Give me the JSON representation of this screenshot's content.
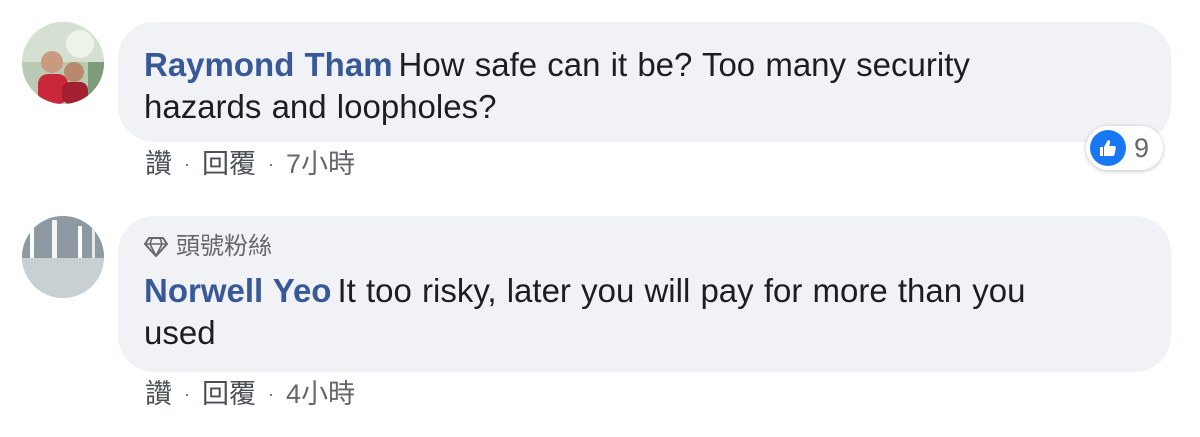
{
  "comments": [
    {
      "author": "Raymond Tham",
      "text_line1": "How safe can it be? Too many security",
      "text_line2": "hazards and loopholes?",
      "badge": "",
      "actions": {
        "like": "讚",
        "reply": "回覆",
        "time": "7小時"
      },
      "reaction_count": "9"
    },
    {
      "author": "Norwell Yeo",
      "text_line1": "It too risky, later you will pay for more than you",
      "text_line2": "used",
      "badge": "頭號粉絲",
      "actions": {
        "like": "讚",
        "reply": "回覆",
        "time": "4小時"
      }
    }
  ],
  "colors": {
    "author": "#385898",
    "bubble": "#f0f2f5",
    "meta": "#65676b",
    "like_blue": "#1877f2"
  },
  "icons": {
    "badge": "diamond-icon",
    "reaction": "thumbs-up-icon"
  }
}
